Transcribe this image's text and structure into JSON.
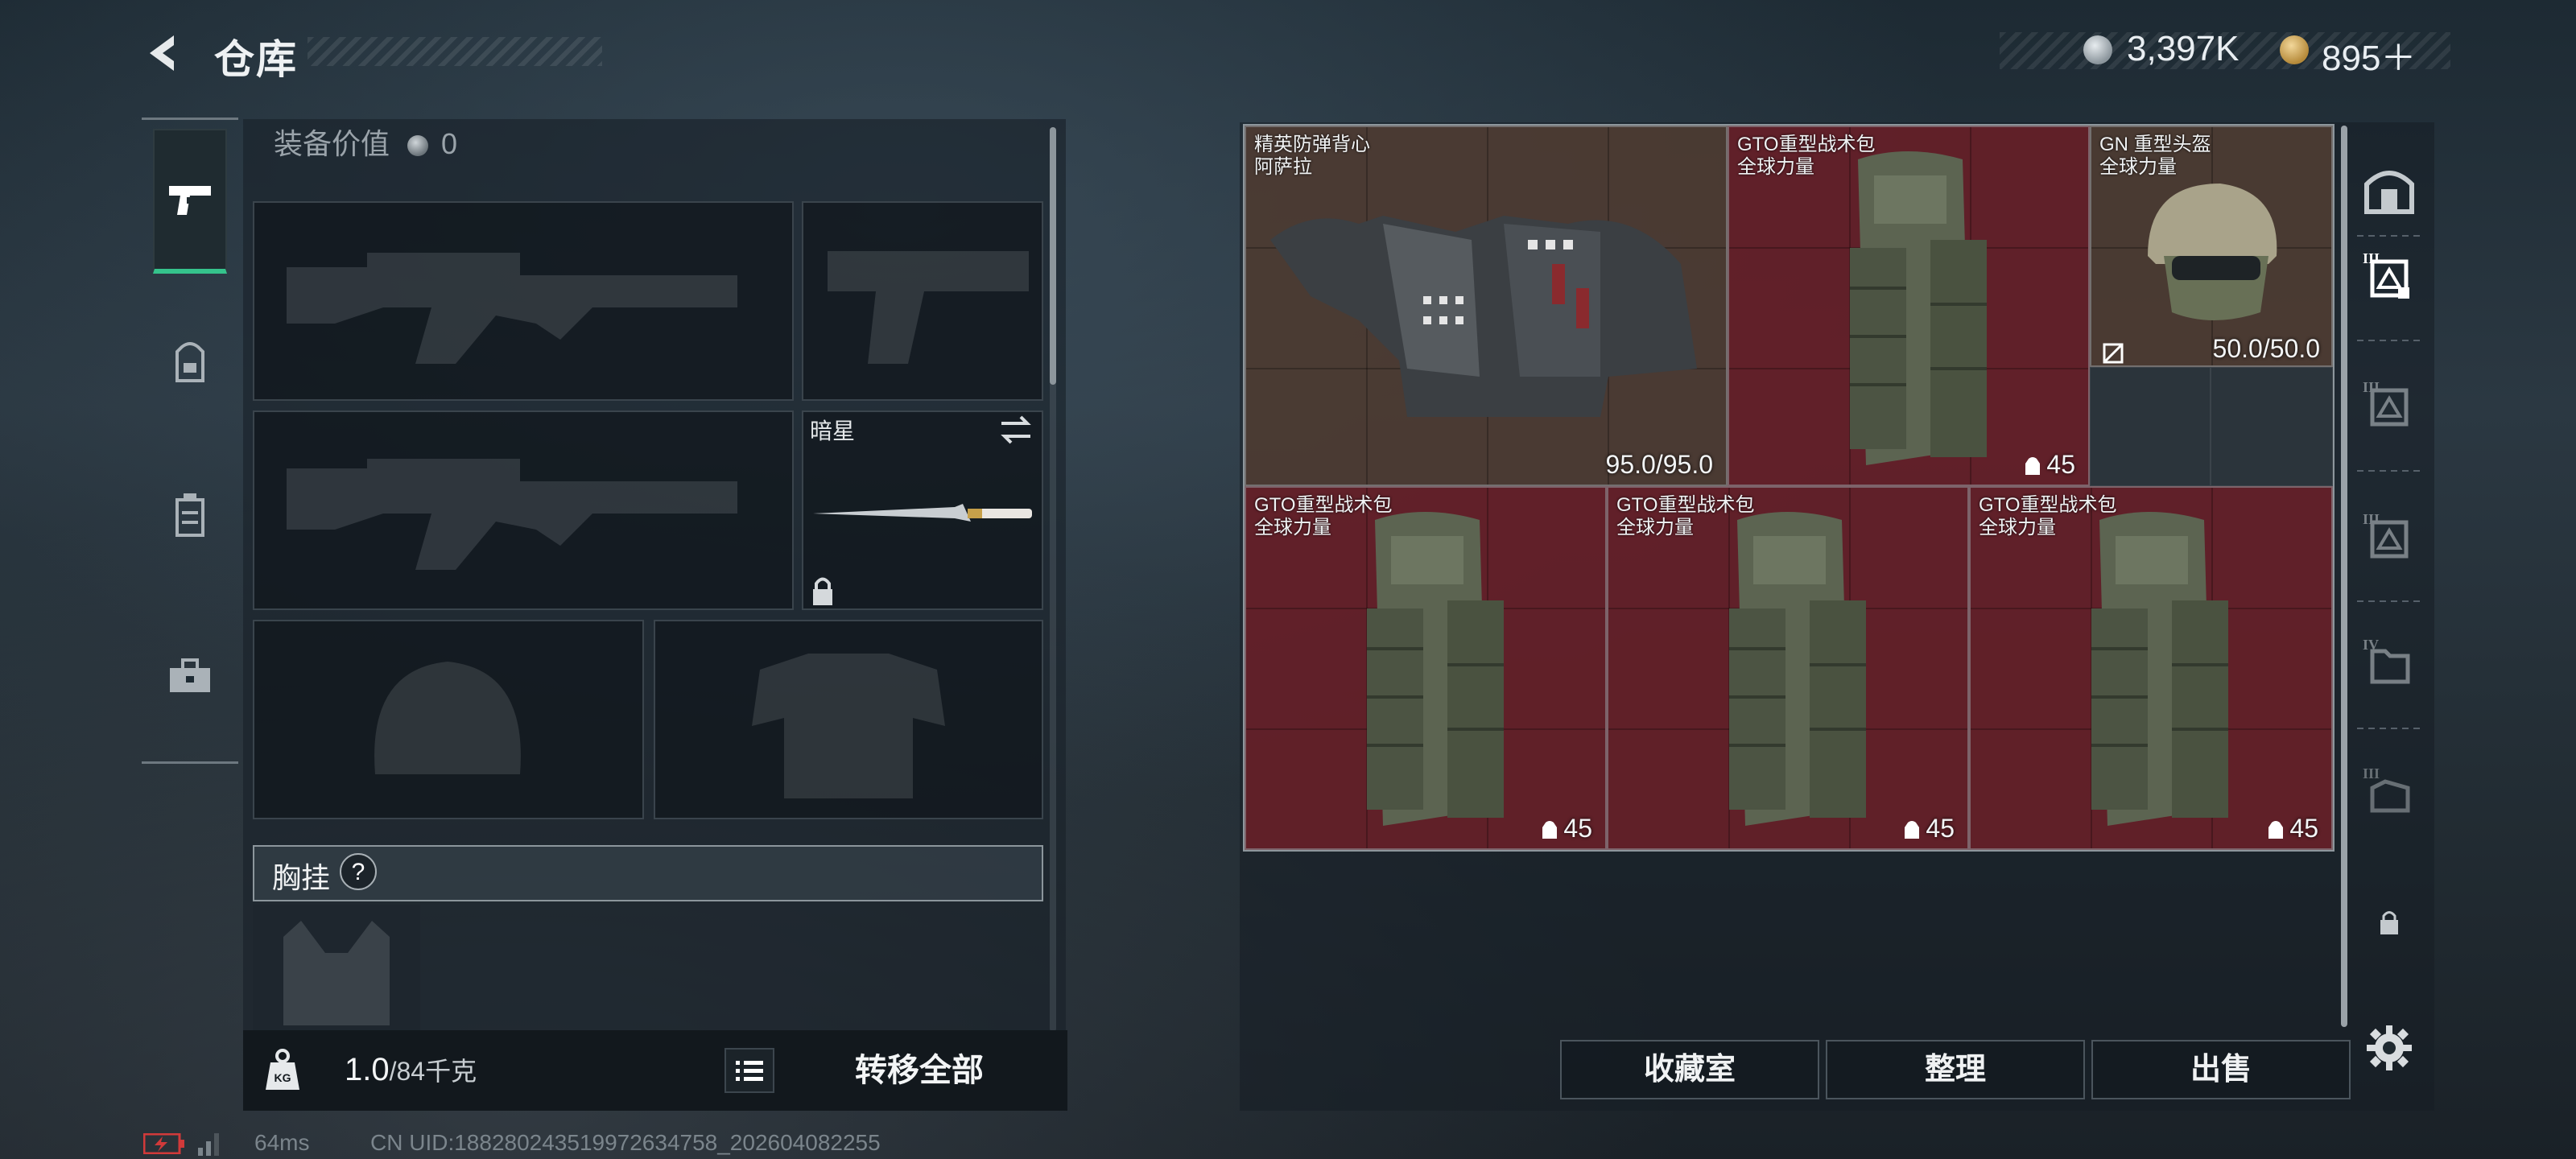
{
  "header": {
    "title": "仓库",
    "currencies": [
      {
        "icon": "silver-coin-icon",
        "value": "3,397K"
      },
      {
        "icon": "gold-coin-icon",
        "value": "895＋"
      }
    ]
  },
  "left_tabs": [
    {
      "icon": "pistol-icon",
      "active": true
    },
    {
      "icon": "backpack-icon",
      "active": false
    },
    {
      "icon": "chest-rig-icon",
      "active": false
    },
    {
      "icon": "toolbox-icon",
      "active": false
    }
  ],
  "loadout": {
    "equipment_value_label": "装备价值",
    "equipment_value": "0",
    "knife_name": "暗星",
    "chest_rig_label": "胸挂",
    "chest_rig_help": "?"
  },
  "bottom_left": {
    "weight_value": "1.0",
    "weight_unit": "/84千克",
    "transfer_label": "转移全部"
  },
  "storage_items": [
    {
      "name": "精英防弹背心",
      "sub": "阿萨拉",
      "value": "95.0/95.0",
      "bg": "brown",
      "icon": "armor-vest-icon"
    },
    {
      "name": "GTO重型战术包",
      "sub": "全球力量",
      "value": "45",
      "bg": "red",
      "icon": "backpack-icon"
    },
    {
      "name": "GN 重型头盔",
      "sub": "全球力量",
      "value": "50.0/50.0",
      "bg": "brown",
      "icon": "helmet-icon"
    },
    {
      "name": "GTO重型战术包",
      "sub": "全球力量",
      "value": "45",
      "bg": "red",
      "icon": "backpack-icon"
    },
    {
      "name": "GTO重型战术包",
      "sub": "全球力量",
      "value": "45",
      "bg": "red",
      "icon": "backpack-icon"
    },
    {
      "name": "GTO重型战术包",
      "sub": "全球力量",
      "value": "45",
      "bg": "red",
      "icon": "backpack-icon"
    }
  ],
  "right_rail": [
    {
      "icon": "vault-icon"
    },
    {
      "icon": "storage-iii-icon",
      "active": true
    },
    {
      "icon": "storage-iii-icon"
    },
    {
      "icon": "storage-iii-icon"
    },
    {
      "icon": "storage-iv-icon"
    },
    {
      "icon": "storage-iii-icon"
    },
    {
      "icon": "lock-icon"
    },
    {
      "icon": "gear-icon"
    }
  ],
  "actions": {
    "collection": "收藏室",
    "sort": "整理",
    "sell": "出售"
  },
  "footer": {
    "ping": "64ms",
    "uid": "CN UID:1882802435199726347​58_202604082255"
  },
  "colors": {
    "accent_green": "#35c38c",
    "item_red": "#702028",
    "item_brown": "#523e34"
  }
}
